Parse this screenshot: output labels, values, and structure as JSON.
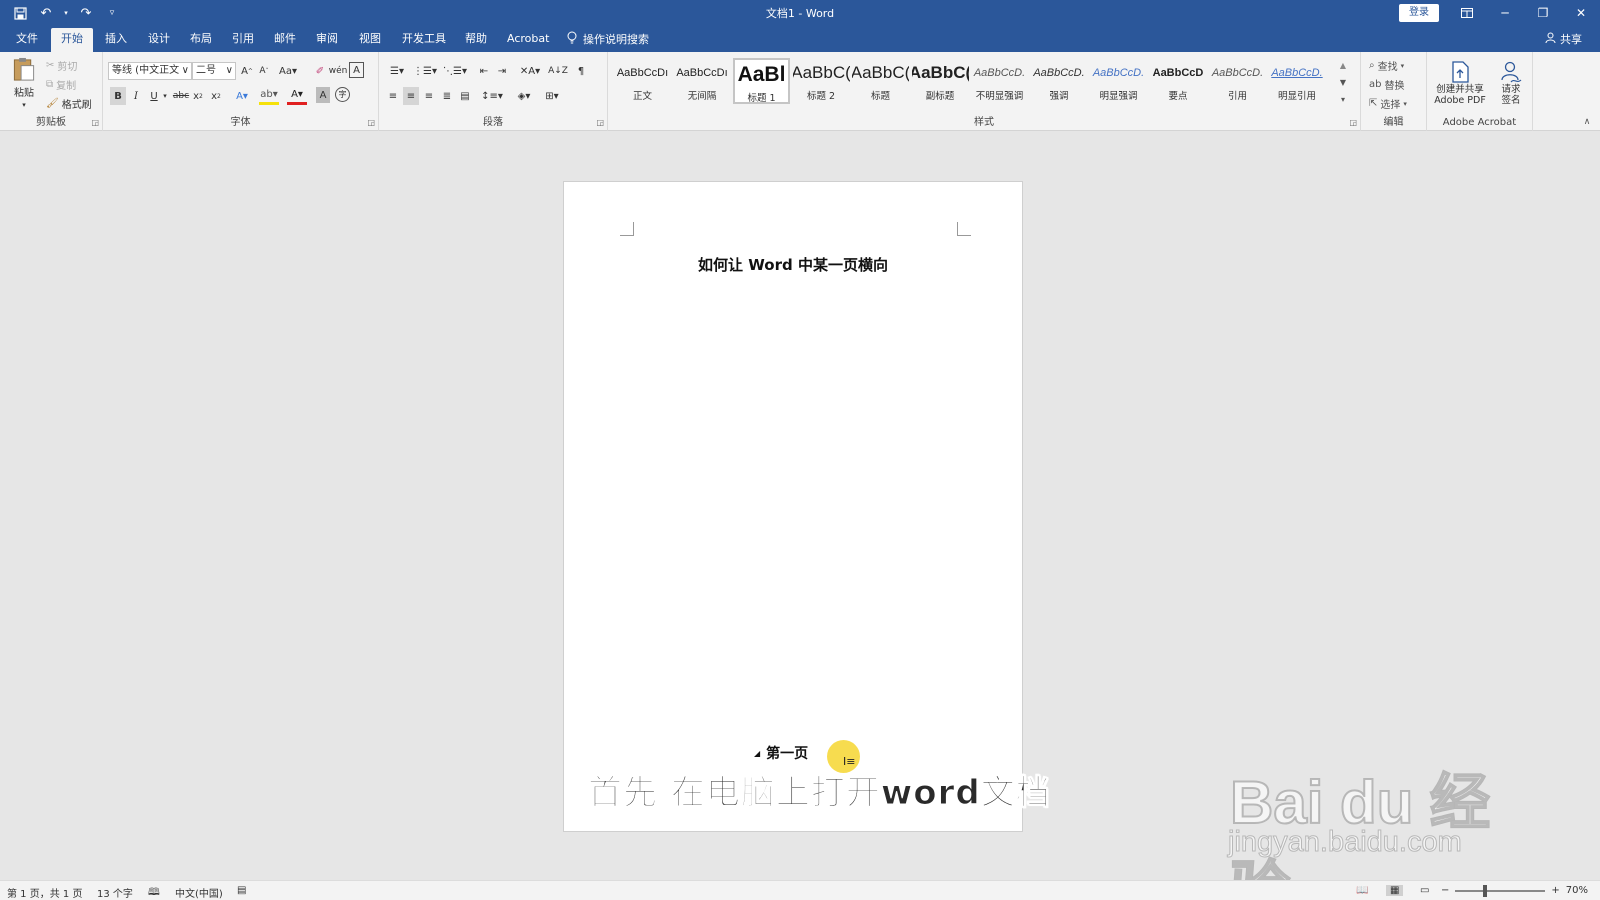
{
  "window": {
    "title": "文档1 - Word",
    "login_label": "登录",
    "controls": [
      "ribbon-display-icon",
      "minimize-icon",
      "restore-icon",
      "close-icon"
    ]
  },
  "quick_access": [
    "save-icon",
    "undo-icon",
    "redo-icon",
    "customize-icon"
  ],
  "tabs": [
    {
      "label": "文件",
      "active": false
    },
    {
      "label": "开始",
      "active": true
    },
    {
      "label": "插入",
      "active": false
    },
    {
      "label": "设计",
      "active": false
    },
    {
      "label": "布局",
      "active": false
    },
    {
      "label": "引用",
      "active": false
    },
    {
      "label": "邮件",
      "active": false
    },
    {
      "label": "审阅",
      "active": false
    },
    {
      "label": "视图",
      "active": false
    },
    {
      "label": "开发工具",
      "active": false
    },
    {
      "label": "帮助",
      "active": false
    },
    {
      "label": "Acrobat",
      "active": false
    }
  ],
  "tell_me": "操作说明搜索",
  "share_label": "共享",
  "ribbon": {
    "clipboard": {
      "label": "剪贴板",
      "paste": "粘贴",
      "cut": "剪切",
      "copy": "复制",
      "format_painter": "格式刷"
    },
    "font": {
      "label": "字体",
      "font_name": "等线 (中文正文",
      "font_size": "二号"
    },
    "paragraph": {
      "label": "段落"
    },
    "styles": {
      "label": "样式",
      "items": [
        {
          "sample": "AaBbCcDı",
          "name": "正文"
        },
        {
          "sample": "AaBbCcDı",
          "name": "无间隔"
        },
        {
          "sample": "AaBl",
          "name": "标题 1"
        },
        {
          "sample": "AaBbC(",
          "name": "标题 2"
        },
        {
          "sample": "AaBbC(",
          "name": "标题"
        },
        {
          "sample": "AaBbC(",
          "name": "副标题"
        },
        {
          "sample": "AaBbCcD.",
          "name": "不明显强调"
        },
        {
          "sample": "AaBbCcD.",
          "name": "强调"
        },
        {
          "sample": "AaBbCcD.",
          "name": "明显强调"
        },
        {
          "sample": "AaBbCcD",
          "name": "要点"
        },
        {
          "sample": "AaBbCcD.",
          "name": "引用"
        },
        {
          "sample": "AaBbCcD.",
          "name": "明显引用"
        }
      ]
    },
    "editing": {
      "label": "编辑",
      "find": "查找",
      "replace": "替换",
      "select": "选择"
    },
    "acrobat": {
      "label": "Adobe Acrobat",
      "create_line1": "创建并共享",
      "create_line2": "Adobe PDF",
      "sign_line1": "请求",
      "sign_line2": "签名"
    }
  },
  "document": {
    "title": "如何让 Word 中某一页横向",
    "paragraph2": "第一页",
    "caption": "首先 在电脑上打开word文档"
  },
  "watermark": {
    "logo": "Bai du 经验",
    "url": "jingyan.baidu.com"
  },
  "status": {
    "page": "第 1 页，共 1 页",
    "words": "13 个字",
    "language": "中文(中国)",
    "zoom": "70%",
    "zoom_level": 0.7
  }
}
